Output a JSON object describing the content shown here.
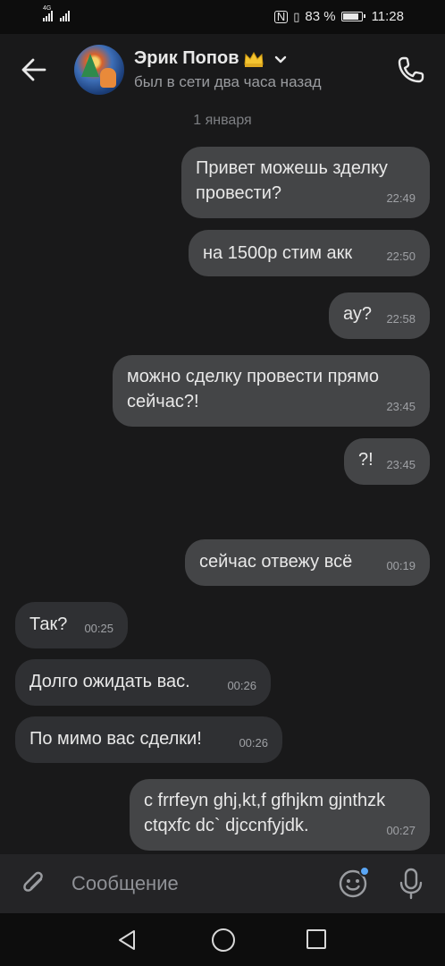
{
  "status_bar": {
    "network": "4G",
    "battery": "83 %",
    "time": "11:28"
  },
  "header": {
    "name": "Эрик Попов",
    "badge_icon": "crown-icon",
    "last_seen": "был в сети два часа назад"
  },
  "date_separator": "1 января",
  "messages": [
    {
      "side": "out",
      "text": "Привет можешь зделку провести?",
      "time": "22:49"
    },
    {
      "side": "out",
      "text": "на 1500р стим акк",
      "time": "22:50"
    },
    {
      "side": "out",
      "text": "ау?",
      "time": "22:58"
    },
    {
      "side": "out",
      "text": "можно сделку провести прямо сейчас?!",
      "time": "23:45"
    },
    {
      "side": "out",
      "text": "?!",
      "time": "23:45"
    },
    {
      "side": "out",
      "text": "сейчас отвежу всё",
      "time": "00:19"
    },
    {
      "side": "in",
      "text": "Так?",
      "time": "00:25"
    },
    {
      "side": "in",
      "text": "Долго ожидать вас.",
      "time": "00:26"
    },
    {
      "side": "in",
      "text": "По мимо вас сделки!",
      "time": "00:26"
    },
    {
      "side": "out",
      "text": "c frrfeyn ghj,kt,f gfhjkm gjnthzk ctqxfc dc` djccnfyjdk.",
      "time": "00:27"
    }
  ],
  "input": {
    "placeholder": "Сообщение"
  },
  "colors": {
    "background": "#19191a",
    "bubble_out": "#444547",
    "bubble_in": "#2f3033",
    "accent": "#5aa6f5"
  }
}
